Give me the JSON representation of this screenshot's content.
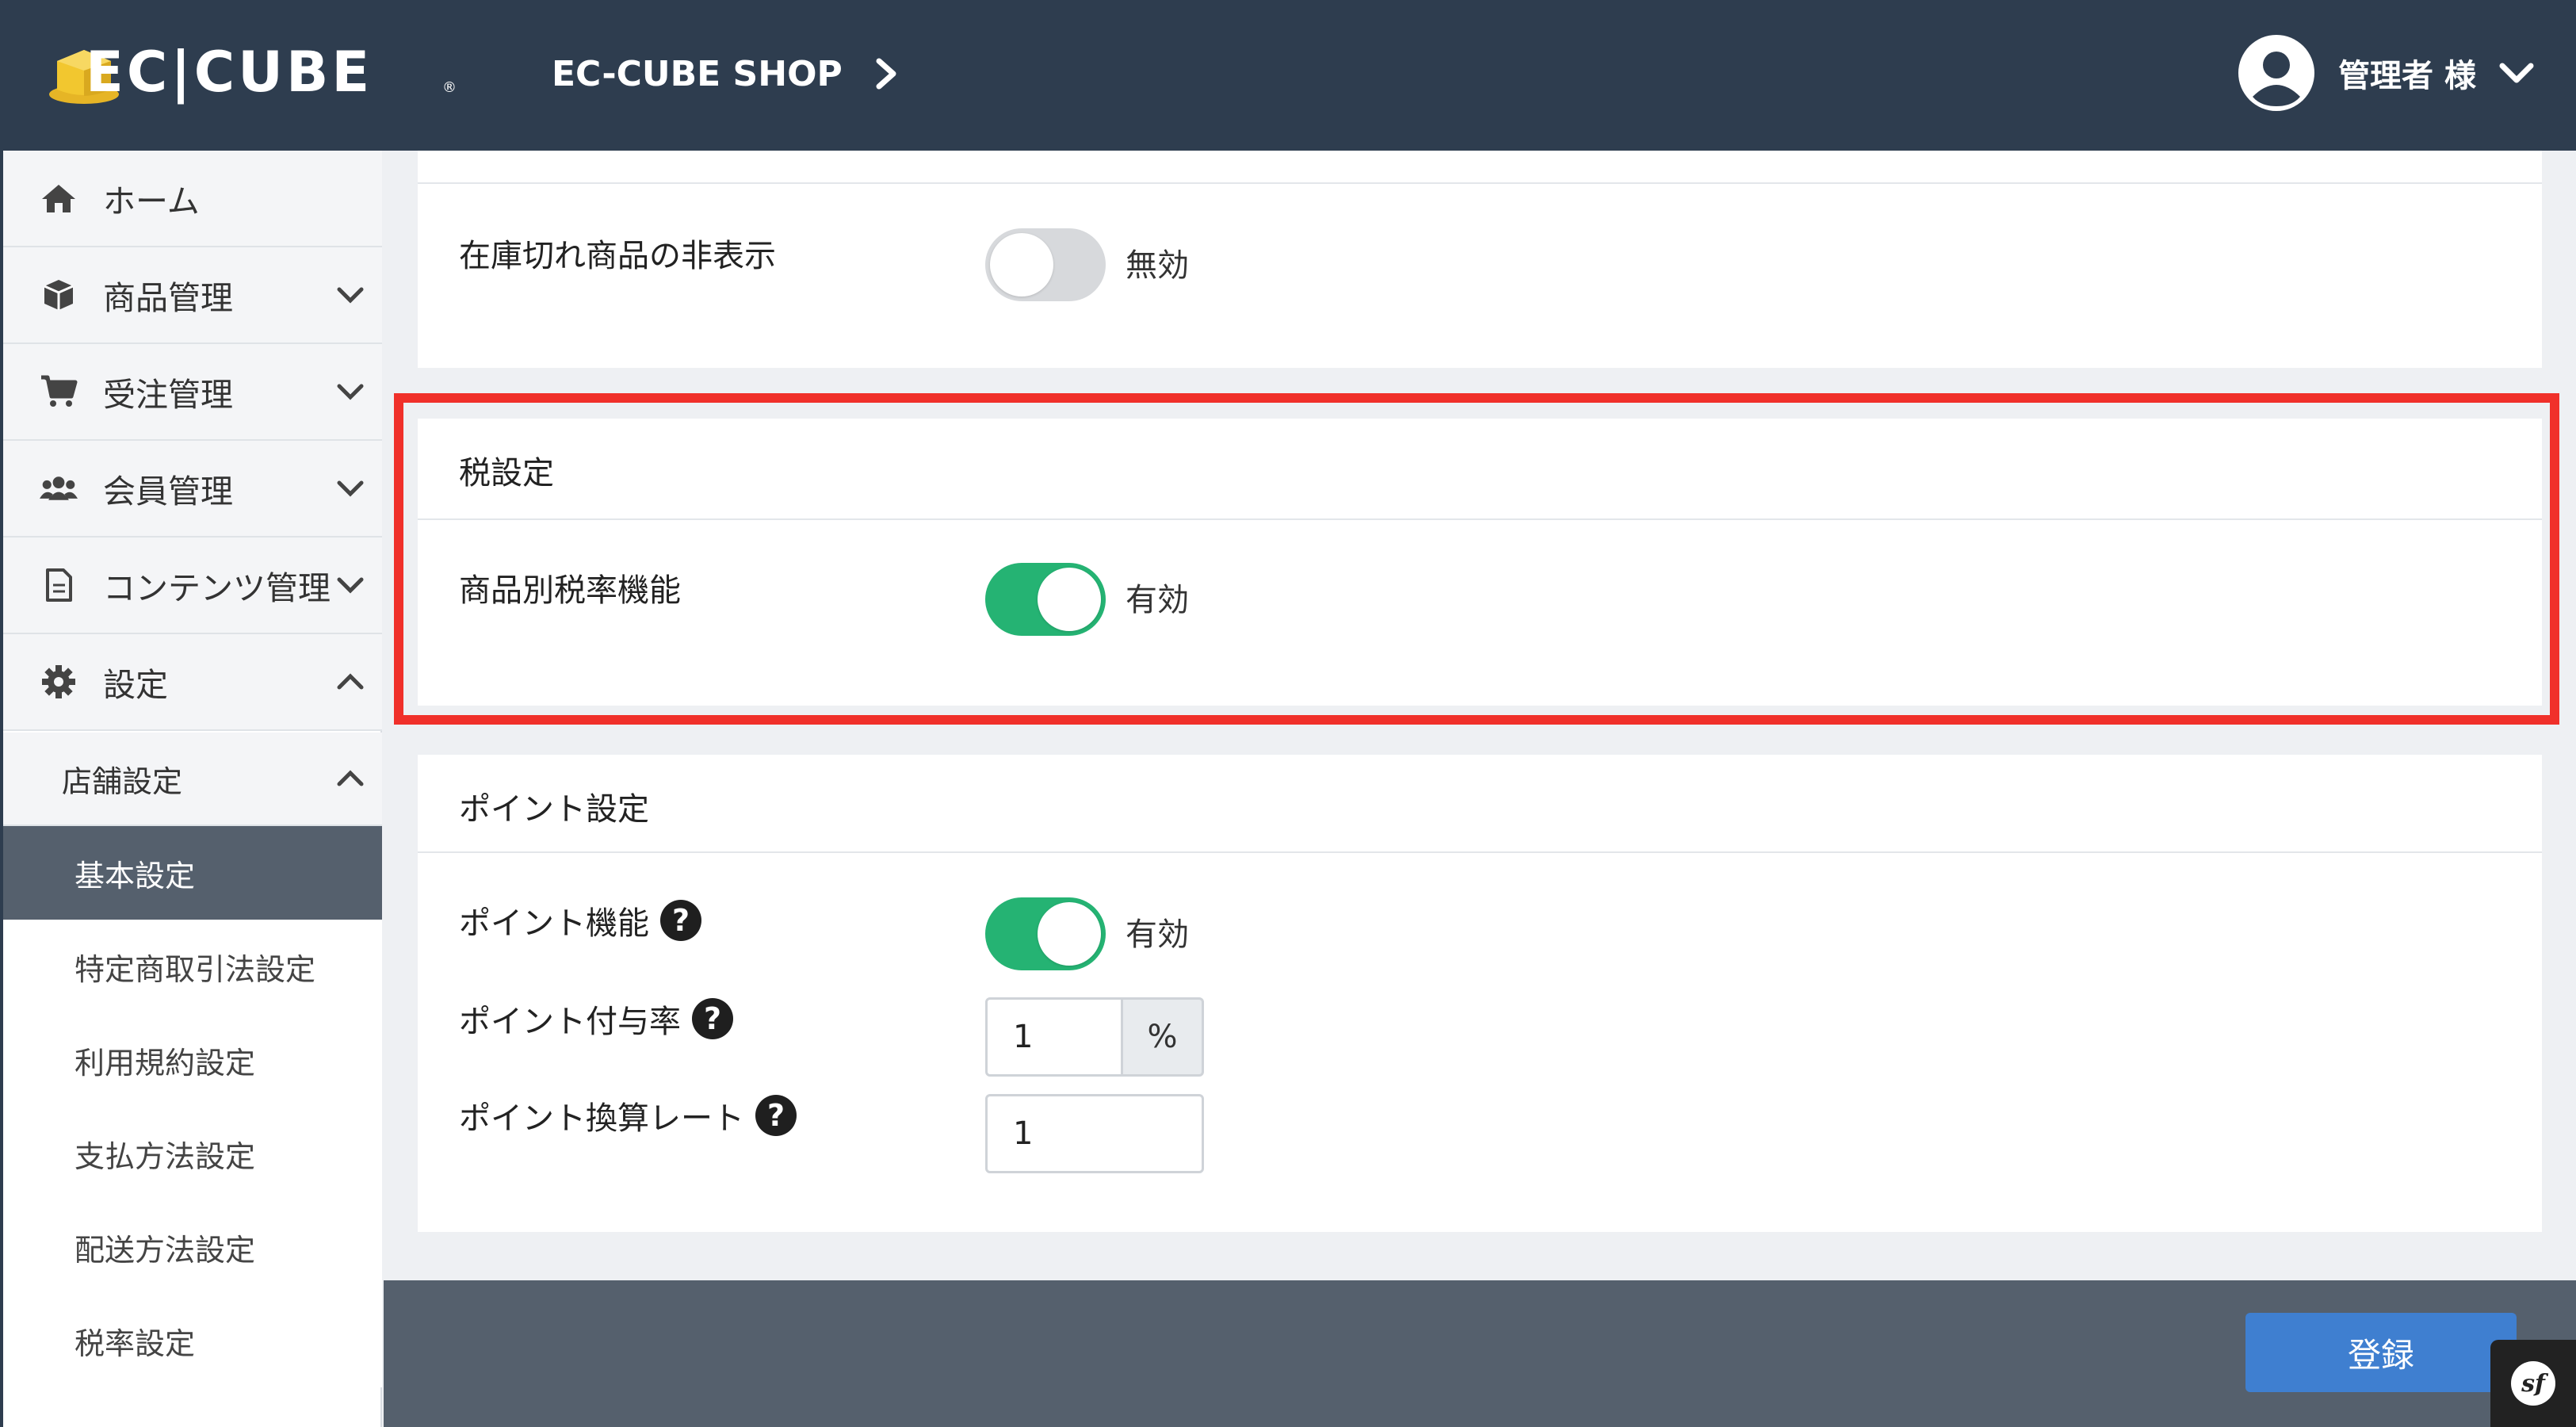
{
  "header": {
    "logo_text": "EC|CUBE",
    "logo_reg": "®",
    "shop_name": "EC-CUBE SHOP",
    "user_name": "管理者 様"
  },
  "sidebar": {
    "items": [
      {
        "label": "ホーム",
        "icon": "home-icon"
      },
      {
        "label": "商品管理",
        "icon": "box-icon"
      },
      {
        "label": "受注管理",
        "icon": "cart-icon"
      },
      {
        "label": "会員管理",
        "icon": "users-icon"
      },
      {
        "label": "コンテンツ管理",
        "icon": "document-icon"
      },
      {
        "label": "設定",
        "icon": "gear-icon"
      }
    ],
    "sub_group": {
      "label": "店舗設定"
    },
    "leaves": [
      {
        "label": "基本設定",
        "active": true
      },
      {
        "label": "特定商取引法設定"
      },
      {
        "label": "利用規約設定"
      },
      {
        "label": "支払方法設定"
      },
      {
        "label": "配送方法設定"
      },
      {
        "label": "税率設定"
      }
    ]
  },
  "stock_card": {
    "label": "在庫切れ商品の非表示",
    "toggle_text": "無効",
    "enabled": false
  },
  "tax_card": {
    "title": "税設定",
    "label": "商品別税率機能",
    "toggle_text": "有効",
    "enabled": true
  },
  "point_card": {
    "title": "ポイント設定",
    "function_label": "ポイント機能",
    "function_toggle_text": "有効",
    "function_enabled": true,
    "rate_label": "ポイント付与率",
    "rate_value": "1",
    "rate_unit": "%",
    "conversion_label": "ポイント換算レート",
    "conversion_value": "1",
    "help_symbol": "?"
  },
  "footer": {
    "save_label": "登録",
    "badge": "sf"
  },
  "colors": {
    "header_bg": "#2e3d4f",
    "toggle_on": "#25b373",
    "highlight": "#f0302a",
    "primary_button": "#3f7fd0"
  }
}
